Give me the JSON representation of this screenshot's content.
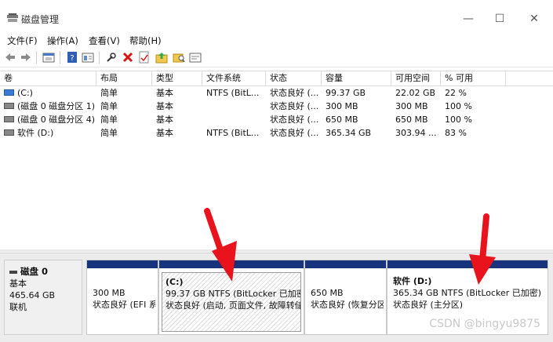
{
  "window": {
    "title": "磁盘管理",
    "buttons": {
      "minimize": "—",
      "maximize": "☐",
      "close": "✕"
    }
  },
  "menu": [
    "文件(F)",
    "操作(A)",
    "查看(V)",
    "帮助(H)"
  ],
  "toolbar_icons": [
    "back-icon",
    "forward-icon",
    "disk-list-icon",
    "help-icon",
    "properties-icon",
    "rescan-icon",
    "delete-icon",
    "check-icon",
    "folder-up-icon",
    "search-folder-icon",
    "refresh-icon"
  ],
  "table": {
    "columns": [
      "卷",
      "布局",
      "类型",
      "文件系统",
      "状态",
      "容量",
      "可用空间",
      "% 可用"
    ],
    "rows": [
      {
        "volume": "(C:)",
        "layout": "简单",
        "type": "基本",
        "fs": "NTFS (BitL...",
        "status": "状态良好 (...",
        "capacity": "99.37 GB",
        "free": "22.02 GB",
        "pct": "22 %",
        "icon": "blue"
      },
      {
        "volume": "(磁盘 0 磁盘分区 1)",
        "layout": "简单",
        "type": "基本",
        "fs": "",
        "status": "状态良好 (...",
        "capacity": "300 MB",
        "free": "300 MB",
        "pct": "100 %",
        "icon": "gray"
      },
      {
        "volume": "(磁盘 0 磁盘分区 4)",
        "layout": "简单",
        "type": "基本",
        "fs": "",
        "status": "状态良好 (...",
        "capacity": "650 MB",
        "free": "650 MB",
        "pct": "100 %",
        "icon": "gray"
      },
      {
        "volume": "软件 (D:)",
        "layout": "简单",
        "type": "基本",
        "fs": "NTFS (BitL...",
        "status": "状态良好 (...",
        "capacity": "365.34 GB",
        "free": "303.94 ...",
        "pct": "83 %",
        "icon": "gray"
      }
    ]
  },
  "disk": {
    "name": "磁盘 0",
    "type": "基本",
    "size": "465.64 GB",
    "state": "联机",
    "partitions": [
      {
        "label": "",
        "line1": "300 MB",
        "line2": "状态良好 (EFI 系"
      },
      {
        "label": "(C:)",
        "line1": "99.37 GB NTFS (BitLocker 已加密)",
        "line2": "状态良好 (启动, 页面文件, 故障转储"
      },
      {
        "label": "",
        "line1": "650 MB",
        "line2": "状态良好 (恢复分区"
      },
      {
        "label": "软件 (D:)",
        "line1": "365.34 GB NTFS (BitLocker 已加密)",
        "line2": "状态良好 (主分区)"
      }
    ]
  },
  "colors": {
    "partition_cap": "#16337c",
    "arrow": "#e8131c"
  },
  "watermark": "CSDN @bingyu9875"
}
